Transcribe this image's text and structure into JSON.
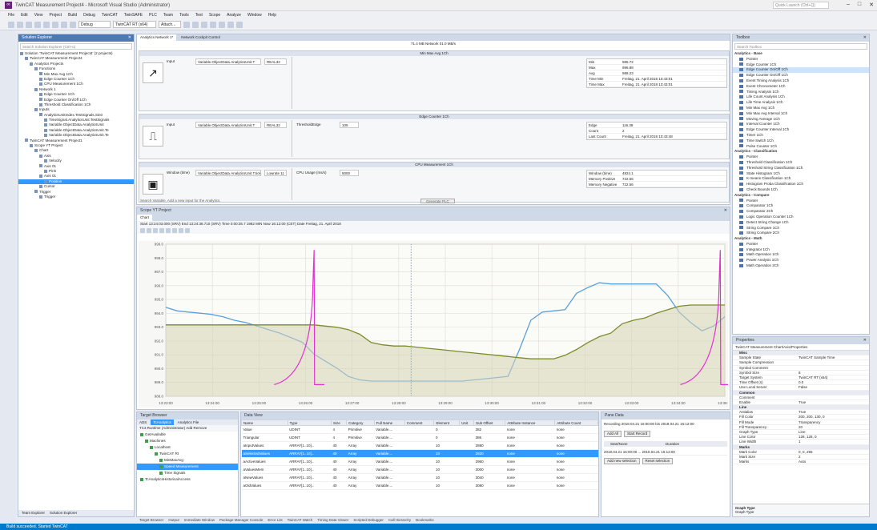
{
  "window": {
    "title": "TwinCAT Measurement Project4 - Microsoft Visual Studio (Administrator)",
    "quick_launch": "Quick Launch (Ctrl+Q)",
    "sign_in": "Sign in"
  },
  "menu": [
    "File",
    "Edit",
    "View",
    "Project",
    "Build",
    "Debug",
    "TwinCAT",
    "TwinSAFE",
    "PLC",
    "Team",
    "Tools",
    "Test",
    "Scope",
    "Analyze",
    "Window",
    "Help"
  ],
  "toolbar": {
    "config": "Debug",
    "platform": "TwinCAT RT (x64)",
    "attach": "Attach..."
  },
  "solution_explorer": {
    "title": "Solution Explorer",
    "search": "Search Solution Explorer (Ctrl+ü)",
    "items": [
      {
        "text": "Solution 'TwinCAT Measurement Project4' (2 projects)",
        "indent": 0
      },
      {
        "text": "TwinCAT Measurement Project4",
        "indent": 1
      },
      {
        "text": "Analytics Projects",
        "indent": 2
      },
      {
        "text": "Functions",
        "indent": 3
      },
      {
        "text": "Min Max Avg 1Ch",
        "indent": 4
      },
      {
        "text": "Edge Counter 1Ch",
        "indent": 4
      },
      {
        "text": "CPU Measurement 1Ch",
        "indent": 4
      },
      {
        "text": "Network 1",
        "indent": 3
      },
      {
        "text": "Edge Counter 1Ch",
        "indent": 4
      },
      {
        "text": "Edge Counter On/Off 1Ch",
        "indent": 4
      },
      {
        "text": "Threshold Classification 1Ch",
        "indent": 4
      },
      {
        "text": "Inputs",
        "indent": 3
      },
      {
        "text": "AnalyticsUnitIndex.TestSignals.Sin0",
        "indent": 4
      },
      {
        "text": "TimeSignal.AnalyticsUnit.TestSignals",
        "indent": 5
      },
      {
        "text": "Variable.ObjectData.AnalyticsUnit",
        "indent": 5
      },
      {
        "text": "Variable.ObjectData.AnalyticsUnit.Te",
        "indent": 5
      },
      {
        "text": "Variable.ObjectData.AnalyticsUnit.Te",
        "indent": 5
      },
      {
        "text": "TwinCAT Measurement Project1",
        "indent": 1
      },
      {
        "text": "Scope YT Project",
        "indent": 2
      },
      {
        "text": "Chart",
        "indent": 3
      },
      {
        "text": "Axis",
        "indent": 4
      },
      {
        "text": "Velocity",
        "indent": 5
      },
      {
        "text": "Axis 01",
        "indent": 4
      },
      {
        "text": "Pinh",
        "indent": 5
      },
      {
        "text": "Axis 01",
        "indent": 4
      },
      {
        "text": "Position",
        "indent": 5
      },
      {
        "text": "Cursor",
        "indent": 4
      },
      {
        "text": "Trigger",
        "indent": 3
      },
      {
        "text": "Trigger",
        "indent": 4
      }
    ],
    "selected_index": 25,
    "tabs": [
      "Team Explorer",
      "Solution Explorer"
    ]
  },
  "document": {
    "tabs": [
      "Analytics Network 1*",
      "Network Cockpit Control"
    ],
    "header": "71.4 MB  Network 01.0 MB/s",
    "blocks": [
      {
        "title": "Min Max Avg 1Ch",
        "icon": "↗",
        "input_label": "Input",
        "input_value": "Variable.ObjectData.AnalyticsUnit.T",
        "input_type": "REAL32",
        "param_label": "",
        "param_value": "",
        "results": [
          {
            "label": "Min",
            "value": "985.72"
          },
          {
            "label": "Max",
            "value": "996.88"
          },
          {
            "label": "Avg",
            "value": "988.23"
          },
          {
            "label": "Time Min",
            "value": "Freitag, 21. April 2018 13:43:01"
          },
          {
            "label": "Time Max",
            "value": "Freitag, 21. April 2018 13:43:01"
          }
        ]
      },
      {
        "title": "Edge Counter 1Ch",
        "icon": "⎍",
        "input_label": "Input",
        "input_value": "Variable.ObjectData.AnalyticsUnit.T",
        "input_type": "REAL32",
        "param_label": "ThresholdEdge",
        "param_value": "105",
        "results": [
          {
            "label": "Edge",
            "value": "116.38"
          },
          {
            "label": "Count",
            "value": "2"
          },
          {
            "label": "Last Count",
            "value": "Freitag, 21. April 2018 13:43:48"
          }
        ]
      },
      {
        "title": "CPU Measurement 1Ch",
        "icon": "▣",
        "input_label": "Window (time)",
        "input_value": "Variable.ObjectData.AnalyticsUnit.T.tick",
        "input_type": "Lowrate 11",
        "param_label": "CPU Usage (ms/s)",
        "param_value": "5000",
        "results": [
          {
            "label": "Window (time)",
            "value": "4824.1"
          },
          {
            "label": "Memory Positive",
            "value": "722.56"
          },
          {
            "label": "Memory Negative",
            "value": "722.56"
          }
        ]
      }
    ],
    "footer_text": "Search Variable, Add a new input for the Analytics.",
    "footer_button": "Generate PLC"
  },
  "scope": {
    "title": "Scope YT Project",
    "tab": "Chart",
    "controls": "Start 13:24:03.000 (SRV)  End 13:24:38.710 (SRV)  Time 0:00:35.7 1982 MIN  Now 16:12:00 (CET)  Date Freitag, 21. April 2018",
    "y_ticks": [
      "999.0",
      "998.0",
      "997.0",
      "996.0",
      "995.0",
      "994.0",
      "993.0",
      "992.0",
      "991.0",
      "990.0",
      "989.0",
      "988.0"
    ],
    "x_ticks": [
      "13:23:00",
      "13:24:00",
      "13:25:00",
      "13:26:00",
      "13:27:00",
      "13:28:00",
      "13:29:00",
      "13:30:00",
      "13:31:00",
      "13:32:00",
      "13:33:00",
      "13:34:00",
      "13:35:00"
    ]
  },
  "chart_data": {
    "type": "line",
    "ylim": [
      987,
      1000
    ],
    "x_steps": 50,
    "series": [
      {
        "name": "",
        "color": "#5aa0dc",
        "values": [
          994.6,
          994.3,
          994.2,
          994.1,
          994.0,
          993.8,
          993.5,
          993.3,
          993.0,
          992.7,
          992.4,
          992.0,
          991.6,
          990.6,
          990.0,
          989.4,
          988.7,
          988.4,
          988.3,
          988.3,
          988.3,
          988.3,
          988.3,
          988.3,
          988.3,
          988.3,
          988.3,
          988.4,
          988.5,
          988.6,
          988.7,
          991.0,
          993.5,
          994.2,
          994.3,
          994.4,
          995.8,
          996.3,
          996.7,
          996.6,
          996.6,
          996.6,
          996.6,
          996.6,
          995.6,
          994.2,
          993.3,
          992.6,
          993.0,
          993.8
        ]
      },
      {
        "name": "",
        "color": "#7a8c2a",
        "values": [
          993.1,
          993.1,
          993.1,
          993.1,
          993.1,
          993.1,
          993.1,
          993.1,
          993.1,
          993.1,
          993.1,
          993.1,
          993.1,
          993.1,
          993.0,
          992.9,
          992.7,
          992.3,
          991.6,
          991.4,
          991.3,
          991.3,
          991.2,
          991.1,
          991.0,
          990.9,
          990.8,
          990.7,
          990.6,
          990.5,
          990.4,
          990.3,
          990.2,
          990.2,
          990.2,
          990.5,
          991.0,
          991.6,
          992.1,
          992.4,
          993.2,
          993.5,
          993.7,
          994.1,
          994.4,
          994.7,
          994.8,
          994.8,
          994.8,
          994.8
        ]
      },
      {
        "name": "",
        "color": "#e030d0",
        "shape": "spikes",
        "spikes": [
          {
            "at": 13.0,
            "peak": 999.5,
            "base": 988.0
          },
          {
            "at": 48.6,
            "peak": 999.5,
            "base": 988.0
          }
        ]
      }
    ]
  },
  "target_browser": {
    "title": "Target Browser",
    "tabs": [
      "ADS",
      "TcAnalytics",
      "Analytics File"
    ],
    "toolbar": "TC3 Runtime (Administrator)   Add   Remove",
    "tree": [
      "GetAvailable",
      "Machines",
      "Localhost",
      "TwinCAT Rt",
      "MinMaxAvg",
      "Speed Measurement",
      "Time Signals",
      "TcAnalyticsHistoricalAccess"
    ]
  },
  "variables": {
    "title": "Data View",
    "columns": [
      "Name",
      "Type",
      "Size",
      "Category",
      "Full Name",
      "Comment",
      "Element",
      "Unit",
      "Sub Offset",
      "Attribute Instance",
      "Attribute Count"
    ],
    "rows": [
      [
        "Value",
        "UDINT",
        "4",
        "Primitive",
        "Variable....",
        "",
        "0",
        "",
        "382",
        "none",
        "none"
      ],
      [
        "Triangular",
        "UDINT",
        "4",
        "Primitive",
        "Variable....",
        "",
        "0",
        "",
        "386",
        "none",
        "none"
      ],
      [
        "aInputValues",
        "ARRAY[1..10]...",
        "40",
        "Array",
        "Variable....",
        "",
        "10",
        "",
        "2880",
        "none",
        "none"
      ],
      [
        "aSelectedValues",
        "ARRAY[1..10]...",
        "40",
        "Array",
        "Variable....",
        "",
        "10",
        "",
        "2920",
        "none",
        "none"
      ],
      [
        "aActiveValues",
        "ARRAY[1..10]...",
        "40",
        "Array",
        "Variable....",
        "",
        "10",
        "",
        "2960",
        "none",
        "none"
      ],
      [
        "aValuesMem",
        "ARRAY[1..10]...",
        "40",
        "Array",
        "Variable....",
        "",
        "10",
        "",
        "3000",
        "none",
        "none"
      ],
      [
        "aNewValues",
        "ARRAY[1..10]...",
        "40",
        "Array",
        "Variable....",
        "",
        "10",
        "",
        "3040",
        "none",
        "none"
      ],
      [
        "aOldValues",
        "ARRAY[1..10]...",
        "40",
        "Array",
        "Variable....",
        "",
        "10",
        "",
        "3080",
        "none",
        "none"
      ]
    ],
    "selected_row": 3
  },
  "pane_data": {
    "title": "Pane Data",
    "line1": "Recording 2018.04.21  16:00:00 bis 2018.04.21 16:12:00",
    "btn1": "Add All",
    "btn2": "Start Record",
    "col1": "Start/None",
    "col2": "Duration",
    "entry": "2018.04.21 16:00:00 ... 2018.04.21 16:12:00",
    "btn3": "Add new selection",
    "btn4": "Reset selection"
  },
  "toolbox": {
    "title": "Toolbox",
    "search": "Search Toolbox",
    "items": [
      {
        "text": "Analytics - Base",
        "cat": true
      },
      {
        "text": "Pointer"
      },
      {
        "text": "Edge Counter 1Ch"
      },
      {
        "text": "Edge Counter On/Off 1Ch",
        "sel": true
      },
      {
        "text": "Edge Counter On/Off 1Ch"
      },
      {
        "text": "Event Timing Analysis 1Ch"
      },
      {
        "text": "Event Chronometer 1Ch"
      },
      {
        "text": "Timing Analysis 1Ch"
      },
      {
        "text": "Life Count Analysis 1Ch"
      },
      {
        "text": "Life Time Analysis 1Ch"
      },
      {
        "text": "Min Max Avg 1Ch"
      },
      {
        "text": "Min Max Avg Interval 1Ch"
      },
      {
        "text": "Moving Average 1Ch"
      },
      {
        "text": "Interval Counter 1Ch"
      },
      {
        "text": "Edge Counter Interval 1Ch"
      },
      {
        "text": "Timer 1Ch"
      },
      {
        "text": "Time Switch 1Ch"
      },
      {
        "text": "Pulse Counter 1Ch"
      },
      {
        "text": "Analytics - Classification",
        "cat": true
      },
      {
        "text": "Pointer"
      },
      {
        "text": "Threshold Classification 1Ch"
      },
      {
        "text": "Threshold String Classification 1Ch"
      },
      {
        "text": "State Histogram 1Ch"
      },
      {
        "text": "K-means Classification 1Ch"
      },
      {
        "text": "Histogram Proba Classification 1Ch"
      },
      {
        "text": "Check Bounds 1Ch"
      },
      {
        "text": "Analytics - Compare",
        "cat": true
      },
      {
        "text": "Pointer"
      },
      {
        "text": "Comparator 1Ch"
      },
      {
        "text": "Comparator 2Ch"
      },
      {
        "text": "Logic Operation Counter 1Ch"
      },
      {
        "text": "Detect String Change 1Ch"
      },
      {
        "text": "String Compare 1Ch"
      },
      {
        "text": "String Compare 2Ch"
      },
      {
        "text": "Analytics - Math",
        "cat": true
      },
      {
        "text": "Pointer"
      },
      {
        "text": "Integrator 1Ch"
      },
      {
        "text": "Math Operation 1Ch"
      },
      {
        "text": "Power Analysis 1Ch"
      },
      {
        "text": "Math Operation 2Ch"
      }
    ]
  },
  "properties": {
    "title": "Properties",
    "object": "TwinCAT Measurement Chart/Axis/Properties",
    "rows": [
      {
        "cat": true,
        "name": "Misc",
        "value": ""
      },
      {
        "name": "Sample State",
        "value": "TwinCAT Sample Time"
      },
      {
        "name": "Sample Compression",
        "value": ""
      },
      {
        "name": "Symbol Comment",
        "value": ""
      },
      {
        "name": "Symbol Size",
        "value": "8"
      },
      {
        "name": "Target System",
        "value": "TwinCAT RT (x64)"
      },
      {
        "name": "Time Offset (s)",
        "value": "0.0"
      },
      {
        "name": "Use Local Server",
        "value": "False"
      },
      {
        "cat": true,
        "name": "Common",
        "value": ""
      },
      {
        "name": "Comment",
        "value": ""
      },
      {
        "name": "Enable",
        "value": "True"
      },
      {
        "cat": true,
        "name": "Line",
        "value": ""
      },
      {
        "name": "Antialias",
        "value": "True"
      },
      {
        "name": "Fill Color",
        "value": "200, 200, 130, 0"
      },
      {
        "name": "Fill Mode",
        "value": "Transparency"
      },
      {
        "name": "Fill Transparency",
        "value": "20"
      },
      {
        "name": "Graph Type",
        "value": "Line"
      },
      {
        "name": "Line Color",
        "value": "128, 128, 0"
      },
      {
        "name": "Line Width",
        "value": "1"
      },
      {
        "cat": true,
        "name": "Marks",
        "value": ""
      },
      {
        "name": "Mark Color",
        "value": "0, 0, 255"
      },
      {
        "name": "Mark Size",
        "value": "2"
      },
      {
        "name": "Marks",
        "value": "Auto"
      }
    ],
    "footer_title": "Graph Type",
    "footer_desc": "Graph Type"
  },
  "bottom_tabs": [
    "Target Browser",
    "Output",
    "Immediate Window",
    "Package Manager Console",
    "Error List",
    "TwinCAT Watch",
    "Timing Data Viewer",
    "Scripted Debugger",
    "Call Hierarchy",
    "Bookmarks"
  ],
  "status": "Build succeeded. Started TwinCAT"
}
